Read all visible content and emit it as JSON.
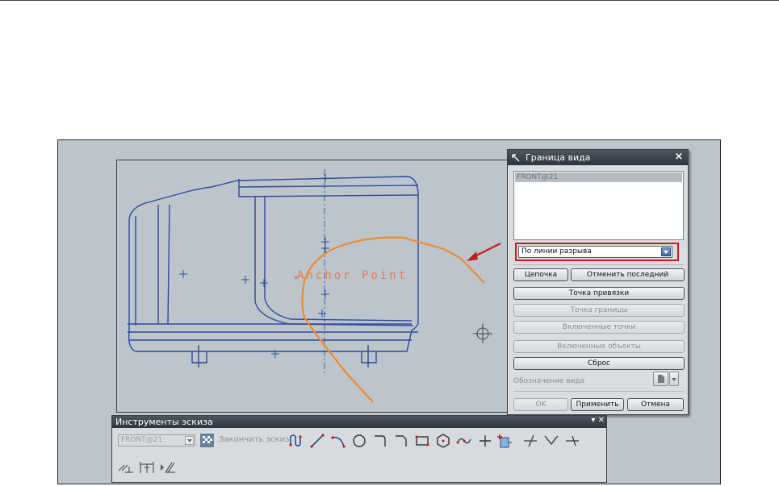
{
  "drawing": {
    "anchor_label": "Anchor Point"
  },
  "dialog": {
    "title": "Граница вида",
    "close": "×",
    "list_items": [
      "FRONT@21"
    ],
    "method_select": "По линии разрыва",
    "buttons": {
      "chain": "Цепочка",
      "undo_last": "Отменить последний",
      "anchor_point": "Точка привязки",
      "boundary_point": "Точка границы",
      "included_points": "Включенные точки",
      "included_objects": "Включенные объекты",
      "reset": "Сброс",
      "ok": "OK",
      "apply": "Применить",
      "cancel": "Отмена"
    },
    "view_label": "Обозначение вида"
  },
  "toolbar": {
    "title": "Инструменты эскиза",
    "controls": "▾ ✕",
    "sketch_select": "FRONT@21",
    "finish_label": "Закончить эскиз"
  },
  "colors": {
    "model_lines": "#2f4a9a",
    "sketch_curve": "#f08a2c",
    "callout_arrow": "#c51c1c",
    "screen_bg": "#bcc5cc"
  }
}
